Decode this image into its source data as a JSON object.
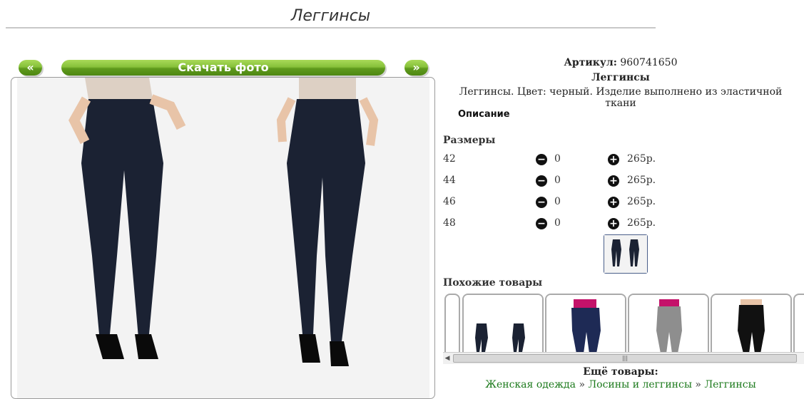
{
  "page": {
    "title": "Леггинсы"
  },
  "nav": {
    "prev_label": "«",
    "download_label": "Скачать фото",
    "next_label": "»"
  },
  "product": {
    "article_label": "Артикул:",
    "article_value": "960741650",
    "name": "Леггинсы",
    "description": "Леггинсы. Цвет: черный. Изделие выполнено из эластичной ткани",
    "description_link": "Описание"
  },
  "sizes": {
    "heading": "Размеры",
    "rows": [
      {
        "size": "42",
        "qty": "0",
        "price": "265р."
      },
      {
        "size": "44",
        "qty": "0",
        "price": "265р."
      },
      {
        "size": "46",
        "qty": "0",
        "price": "265р."
      },
      {
        "size": "48",
        "qty": "0",
        "price": "265р."
      }
    ]
  },
  "similar": {
    "heading": "Похожие товары"
  },
  "more": {
    "heading": "Ещё товары:",
    "crumbs": [
      "Женская одежда",
      "Лосины и леггинсы",
      "Леггинсы"
    ],
    "separator": "»"
  },
  "colors": {
    "button_green": "#6aa628",
    "link_green": "#1c7a1c"
  }
}
